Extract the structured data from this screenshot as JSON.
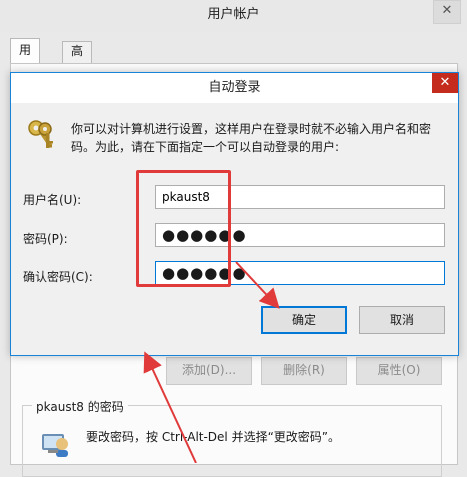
{
  "background_window": {
    "title": "用户帐户",
    "close_glyph": "✕",
    "tabs": [
      {
        "label": "用户",
        "active": true
      },
      {
        "label": "高级",
        "active": false
      }
    ],
    "buttons": {
      "add": "添加(D)...",
      "delete": "删除(R)",
      "properties": "属性(O)"
    },
    "password_group": {
      "title": "pkaust8 的密码",
      "text": "要改密码，按 Ctrl-Alt-Del 并选择“更改密码”。",
      "icon": "user-password-icon"
    }
  },
  "dialog": {
    "title": "自动登录",
    "close_glyph": "✕",
    "icon": "keys-icon",
    "description": "你可以对计算机进行设置，这样用户在登录时就不必输入用户名和密码。为此，请在下面指定一个可以自动登录的用户:",
    "fields": {
      "username_label": "用户名(U):",
      "username_value": "pkaust8",
      "password_label": "密码(P):",
      "password_value": "●●●●●●",
      "confirm_label": "确认密码(C):",
      "confirm_value": "●●●●●●"
    },
    "buttons": {
      "ok": "确定",
      "cancel": "取消"
    }
  },
  "colors": {
    "annotation_red": "#e03a3a",
    "accent_blue": "#0078d7",
    "close_red": "#c42b1c"
  }
}
